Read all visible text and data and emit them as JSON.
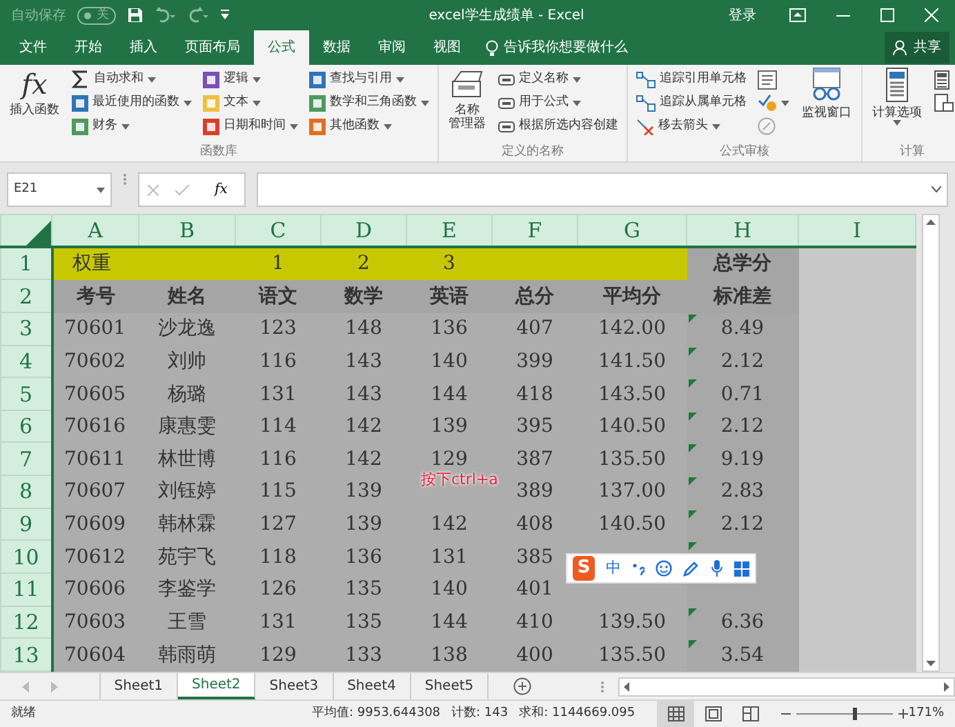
{
  "title_bar": {
    "autosave_label": "自动保存",
    "autosave": {
      "on": false,
      "label": "关"
    },
    "title": "excel学生成绩单 - Excel",
    "signin": "登录"
  },
  "ribbon_tabs": [
    {
      "label": "文件",
      "selected": false
    },
    {
      "label": "开始",
      "selected": false
    },
    {
      "label": "插入",
      "selected": false
    },
    {
      "label": "页面布局",
      "selected": false
    },
    {
      "label": "公式",
      "selected": true
    },
    {
      "label": "数据",
      "selected": false
    },
    {
      "label": "审阅",
      "selected": false
    },
    {
      "label": "视图",
      "selected": false
    }
  ],
  "tell_me": "告诉我你想要做什么",
  "share": "共享",
  "ribbon_groups": [
    {
      "label": "函数库",
      "buttons": [
        {
          "kind": "large",
          "glyph": "fx",
          "lines": [
            "插入函数"
          ],
          "dropdown": false
        },
        {
          "kind": "small",
          "label": "自动求和",
          "dropdown": true
        },
        {
          "kind": "small",
          "label": "最近使用的函数",
          "dropdown": true
        },
        {
          "kind": "small",
          "label": "财务",
          "dropdown": true
        },
        {
          "kind": "small",
          "label": "逻辑",
          "dropdown": true
        },
        {
          "kind": "small",
          "label": "文本",
          "dropdown": true
        },
        {
          "kind": "small",
          "label": "日期和时间",
          "dropdown": true
        },
        {
          "kind": "small",
          "label": "查找与引用",
          "dropdown": true
        },
        {
          "kind": "small",
          "label": "数学和三角函数",
          "dropdown": true
        },
        {
          "kind": "small",
          "label": "其他函数",
          "dropdown": true
        }
      ]
    },
    {
      "label": "定义的名称",
      "buttons": [
        {
          "kind": "large",
          "lines": [
            "名称",
            "管理器"
          ],
          "dropdown": false
        },
        {
          "kind": "small",
          "label": "定义名称",
          "dropdown": true
        },
        {
          "kind": "small",
          "label": "用于公式",
          "dropdown": true
        },
        {
          "kind": "small",
          "label": "根据所选内容创建",
          "dropdown": false
        }
      ]
    },
    {
      "label": "公式审核",
      "buttons": [
        {
          "kind": "small",
          "label": "追踪引用单元格",
          "dropdown": false
        },
        {
          "kind": "small",
          "label": "追踪从属单元格",
          "dropdown": false
        },
        {
          "kind": "small",
          "label": "移去箭头",
          "dropdown": true
        },
        {
          "kind": "icon",
          "dropdown": false
        },
        {
          "kind": "icon",
          "dropdown": true
        },
        {
          "kind": "icon",
          "dropdown": false
        },
        {
          "kind": "large",
          "lines": [
            "监视窗口"
          ],
          "dropdown": false
        }
      ]
    },
    {
      "label": "计算",
      "buttons": [
        {
          "kind": "large",
          "lines": [
            "计算选项"
          ],
          "dropdown": true
        },
        {
          "kind": "icon",
          "dropdown": false
        },
        {
          "kind": "icon",
          "dropdown": false
        }
      ]
    }
  ],
  "name_box": "E21",
  "formula_bar": {
    "fx": "fx"
  },
  "grid": {
    "all_selected": true,
    "columns": [
      "A",
      "B",
      "C",
      "D",
      "E",
      "F",
      "G",
      "H",
      "I"
    ],
    "rows": [
      {
        "header": "1",
        "kind": "weight",
        "error_flag": false,
        "cells": [
          "权重",
          null,
          "1",
          "2",
          "3",
          null,
          null,
          "总学分"
        ]
      },
      {
        "header": "2",
        "kind": "header",
        "error_flag": false,
        "cells": [
          "考号",
          "姓名",
          "语文",
          "数学",
          "英语",
          "总分",
          "平均分",
          "标准差"
        ]
      },
      {
        "header": "3",
        "kind": "data",
        "error_flag": true,
        "cells": [
          "70601",
          "沙龙逸",
          "123",
          "148",
          "136",
          "407",
          "142.00",
          "8.49"
        ]
      },
      {
        "header": "4",
        "kind": "data",
        "error_flag": true,
        "cells": [
          "70602",
          "刘帅",
          "116",
          "143",
          "140",
          "399",
          "141.50",
          "2.12"
        ]
      },
      {
        "header": "5",
        "kind": "data",
        "error_flag": true,
        "cells": [
          "70605",
          "杨璐",
          "131",
          "143",
          "144",
          "418",
          "143.50",
          "0.71"
        ]
      },
      {
        "header": "6",
        "kind": "data",
        "error_flag": true,
        "cells": [
          "70616",
          "康惠雯",
          "114",
          "142",
          "139",
          "395",
          "140.50",
          "2.12"
        ]
      },
      {
        "header": "7",
        "kind": "data",
        "error_flag": true,
        "cells": [
          "70611",
          "林世博",
          "116",
          "142",
          "129",
          "387",
          "135.50",
          "9.19"
        ]
      },
      {
        "header": "8",
        "kind": "data",
        "error_flag": true,
        "cells": [
          "70607",
          "刘钰婷",
          "115",
          "139",
          null,
          "389",
          "137.00",
          "2.83"
        ]
      },
      {
        "header": "9",
        "kind": "data",
        "error_flag": true,
        "cells": [
          "70609",
          "韩林霖",
          "127",
          "139",
          "142",
          "408",
          "140.50",
          "2.12"
        ]
      },
      {
        "header": "10",
        "kind": "data",
        "error_flag": true,
        "cells": [
          "70612",
          "苑宇飞",
          "118",
          "136",
          "131",
          "385",
          null,
          null
        ]
      },
      {
        "header": "11",
        "kind": "data",
        "error_flag": false,
        "cells": [
          "70606",
          "李鉴学",
          "126",
          "135",
          "140",
          "401",
          null,
          null
        ]
      },
      {
        "header": "12",
        "kind": "data",
        "error_flag": true,
        "cells": [
          "70603",
          "王雪",
          "131",
          "135",
          "144",
          "410",
          "139.50",
          "6.36"
        ]
      },
      {
        "header": "13",
        "kind": "data",
        "error_flag": true,
        "cells": [
          "70604",
          "韩雨萌",
          "129",
          "133",
          "138",
          "400",
          "135.50",
          "3.54"
        ]
      }
    ]
  },
  "annotation": "按下ctrl+a",
  "ime_toolbar": {
    "logo": "S",
    "mode": "中"
  },
  "sheet_tabs": [
    {
      "label": "Sheet1",
      "selected": false
    },
    {
      "label": "Sheet2",
      "selected": true
    },
    {
      "label": "Sheet3",
      "selected": false
    },
    {
      "label": "Sheet4",
      "selected": false
    },
    {
      "label": "Sheet5",
      "selected": false
    }
  ],
  "status_bar": {
    "state": "就绪",
    "average": "平均值: 9953.644308",
    "count": "计数: 143",
    "sum": "求和: 1144669.095",
    "views": [
      {
        "selected": true
      },
      {
        "selected": false
      },
      {
        "selected": false
      }
    ],
    "zoom": {
      "level": 0.6
    },
    "zoom_label": "171%"
  }
}
